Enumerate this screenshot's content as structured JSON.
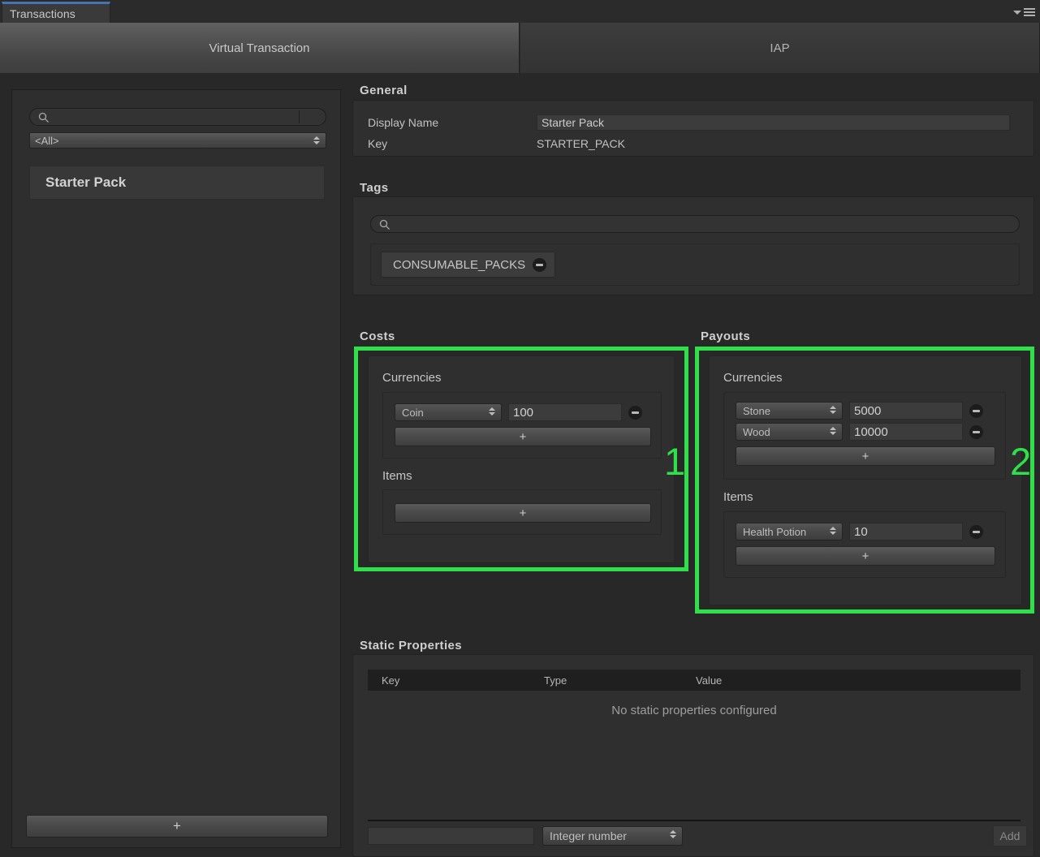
{
  "window": {
    "tab_label": "Transactions",
    "menu_icon": "hamburger-menu-icon",
    "dropdown_icon": "chevron-down-icon",
    "accent_color": "#4573b4"
  },
  "tabs": [
    {
      "label": "Virtual Transaction",
      "active": true
    },
    {
      "label": "IAP",
      "active": false
    }
  ],
  "sidebar": {
    "search": {
      "value": "",
      "placeholder": "",
      "icon": "search-icon"
    },
    "filter": {
      "selected": "<All>"
    },
    "items": [
      {
        "label": "Starter Pack",
        "selected": true
      }
    ],
    "add_button_label": "+"
  },
  "general": {
    "title": "General",
    "display_name_label": "Display Name",
    "display_name_value": "Starter Pack",
    "key_label": "Key",
    "key_value": "STARTER_PACK"
  },
  "tags": {
    "title": "Tags",
    "search": {
      "value": "",
      "placeholder": "",
      "icon": "search-icon"
    },
    "chips": [
      {
        "label": "CONSUMABLE_PACKS",
        "remove_icon": "minus-circle-icon"
      }
    ]
  },
  "costs": {
    "title": "Costs",
    "highlight_number": "1",
    "highlight_color": "#2fe04b",
    "currencies": {
      "title": "Currencies",
      "rows": [
        {
          "name": "Coin",
          "amount": "100",
          "remove_icon": "minus-circle-icon"
        }
      ],
      "add_label": "+"
    },
    "items": {
      "title": "Items",
      "rows": [],
      "add_label": "+"
    }
  },
  "payouts": {
    "title": "Payouts",
    "highlight_number": "2",
    "highlight_color": "#2fe04b",
    "currencies": {
      "title": "Currencies",
      "rows": [
        {
          "name": "Stone",
          "amount": "5000",
          "remove_icon": "minus-circle-icon"
        },
        {
          "name": "Wood",
          "amount": "10000",
          "remove_icon": "minus-circle-icon"
        }
      ],
      "add_label": "+"
    },
    "items": {
      "title": "Items",
      "rows": [
        {
          "name": "Health Potion",
          "amount": "10",
          "remove_icon": "minus-circle-icon"
        }
      ],
      "add_label": "+"
    }
  },
  "static_properties": {
    "title": "Static Properties",
    "columns": {
      "key": "Key",
      "type": "Type",
      "value": "Value"
    },
    "empty_message": "No static properties configured",
    "new_key_value": "",
    "new_type_selected": "Integer number",
    "add_button_label": "Add"
  }
}
